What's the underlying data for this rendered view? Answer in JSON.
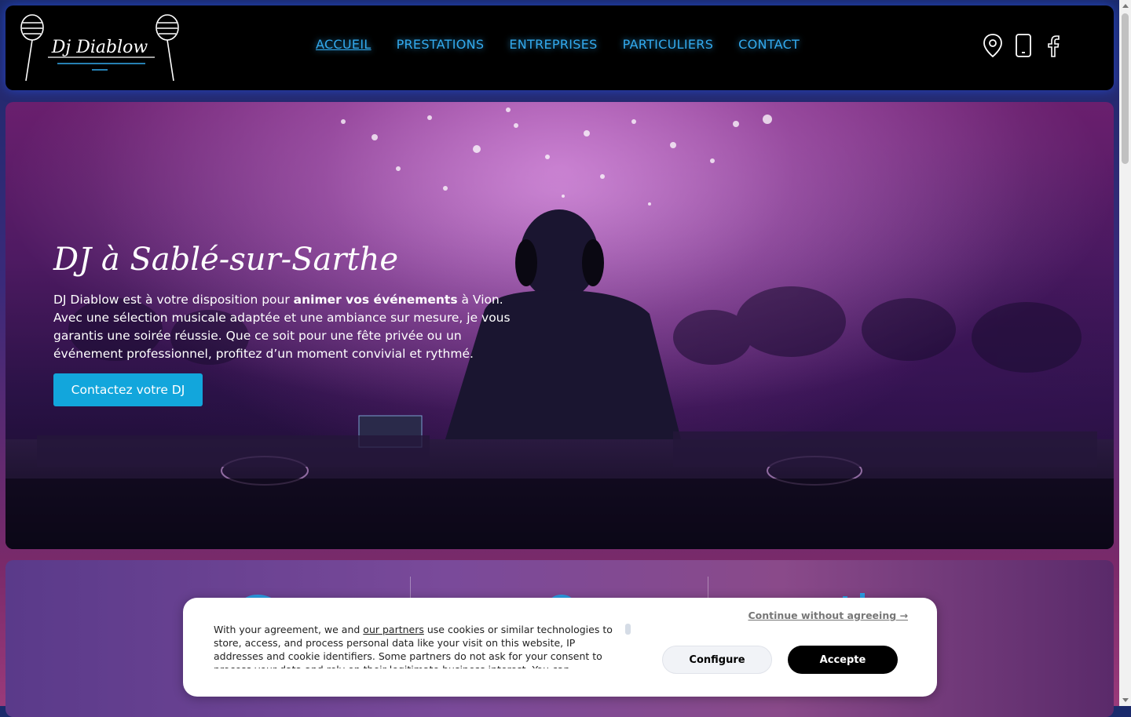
{
  "header": {
    "logo_text": "Dj Diablow",
    "nav": [
      {
        "label": "ACCUEIL",
        "active": true
      },
      {
        "label": "PRESTATIONS",
        "active": false
      },
      {
        "label": "ENTREPRISES",
        "active": false
      },
      {
        "label": "PARTICULIERS",
        "active": false
      },
      {
        "label": "CONTACT",
        "active": false
      }
    ],
    "icons": [
      "location-pin-icon",
      "phone-icon",
      "facebook-icon"
    ]
  },
  "hero": {
    "title": "DJ à Sablé-sur-Sarthe",
    "text_before": "DJ Diablow est à votre disposition pour ",
    "text_bold": "animer vos événements",
    "text_after": " à Vion. Avec une sélection musicale adaptée et une ambiance sur mesure, je vous garantis une soirée réussie. Que ce soit pour une fête privée ou un événement professionnel, profitez d’un moment convivial et rythmé.",
    "cta_label": "Contactez votre DJ"
  },
  "cookie": {
    "text_before": "With your agreement, we and ",
    "partners_link": "our partners",
    "text_after": " use cookies or similar technologies to store, access, and process personal data like your visit on this website, IP addresses and cookie identifiers. Some partners do not ask for your consent to process your data and rely on their legitimate business interest. You can",
    "continue_label": "Continue without agreeing →",
    "configure_label": "Configure",
    "accept_label": "Accepte"
  },
  "colors": {
    "accent": "#12a6dc",
    "nav_link": "#33aaee",
    "header_bg": "#000000"
  }
}
